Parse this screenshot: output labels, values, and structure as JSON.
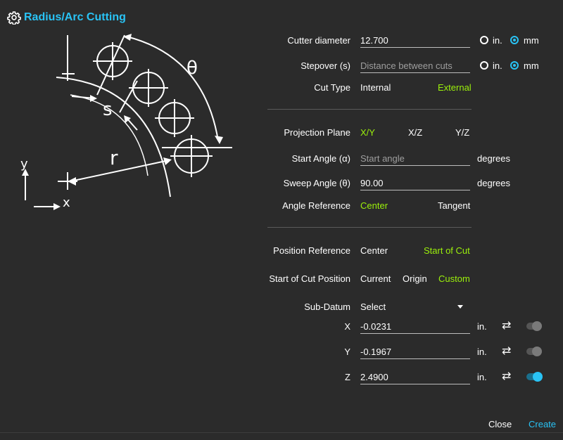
{
  "header": {
    "title": "Radius/Arc Cutting",
    "icon": "gear-icon"
  },
  "diagram": {
    "theta": "θ",
    "s": "s",
    "r": "r",
    "y": "y",
    "x": "x"
  },
  "cutter_diameter": {
    "label": "Cutter diameter",
    "value": "12.700",
    "unit_in": "in.",
    "unit_mm": "mm",
    "selected": "mm"
  },
  "stepover": {
    "label": "Stepover (s)",
    "placeholder": "Distance between cuts",
    "unit_in": "in.",
    "unit_mm": "mm",
    "selected": "mm"
  },
  "cut_type": {
    "label": "Cut Type",
    "options": [
      "Internal",
      "External"
    ],
    "selected": "External"
  },
  "projection_plane": {
    "label": "Projection Plane",
    "options": [
      "X/Y",
      "X/Z",
      "Y/Z"
    ],
    "selected": "X/Y"
  },
  "start_angle": {
    "label": "Start Angle (α)",
    "placeholder": "Start angle",
    "unit": "degrees"
  },
  "sweep_angle": {
    "label": "Sweep Angle (θ)",
    "value": "90.00",
    "unit": "degrees"
  },
  "angle_reference": {
    "label": "Angle Reference",
    "options": [
      "Center",
      "Tangent"
    ],
    "selected": "Center"
  },
  "position_reference": {
    "label": "Position Reference",
    "options": [
      "Center",
      "Start of Cut"
    ],
    "selected": "Start of Cut"
  },
  "start_of_cut_position": {
    "label": "Start of Cut Position",
    "options": [
      "Current",
      "Origin",
      "Custom"
    ],
    "selected": "Custom"
  },
  "sub_datum": {
    "label": "Sub-Datum",
    "value": "Select"
  },
  "coords": [
    {
      "axis": "X",
      "value": "-0.0231",
      "unit": "in.",
      "enabled": false
    },
    {
      "axis": "Y",
      "value": "-0.1967",
      "unit": "in.",
      "enabled": false
    },
    {
      "axis": "Z",
      "value": "2.4900",
      "unit": "in.",
      "enabled": true
    }
  ],
  "footer": {
    "close": "Close",
    "create": "Create"
  },
  "colors": {
    "accent": "#29c3f5",
    "selected": "#9bf00b",
    "background": "#2b2b2b"
  }
}
